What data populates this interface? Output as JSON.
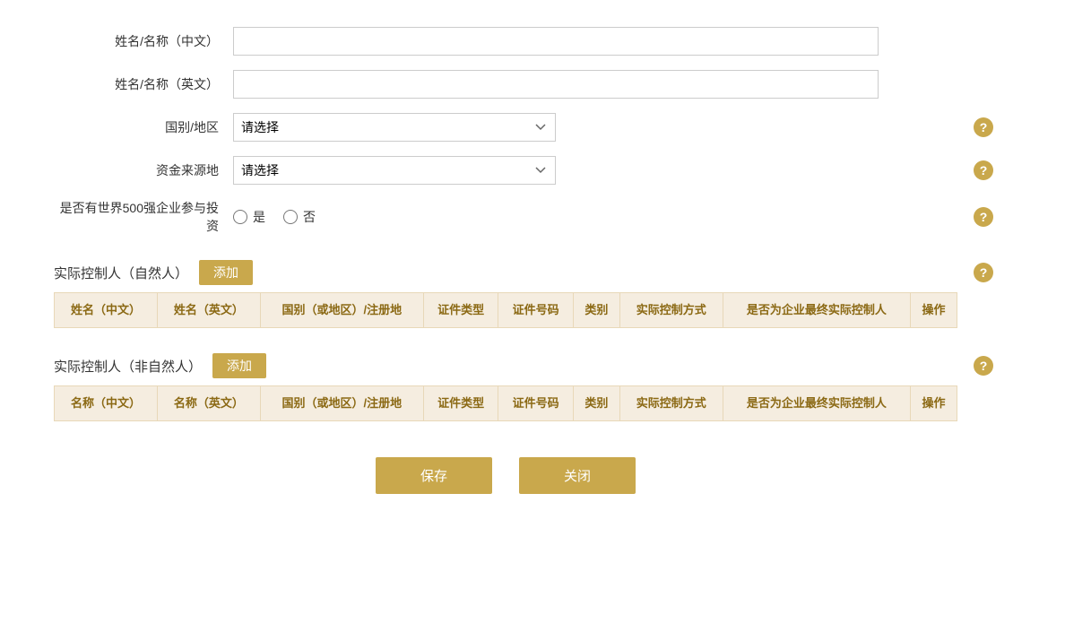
{
  "form": {
    "name_cn_label": "姓名/名称（中文）",
    "name_en_label": "姓名/名称（英文）",
    "country_label": "国别/地区",
    "country_placeholder": "请选择",
    "funds_label": "资金来源地",
    "funds_placeholder": "请选择",
    "fortune500_label": "是否有世界500强企业参与投资",
    "yes_label": "是",
    "no_label": "否"
  },
  "natural_person_section": {
    "title": "实际控制人（自然人）",
    "add_button": "添加",
    "columns": [
      "姓名（中文）",
      "姓名（英文）",
      "国别（或地区）/注册地",
      "证件类型",
      "证件号码",
      "类别",
      "实际控制方式",
      "是否为企业最终实际控制人",
      "操作"
    ]
  },
  "non_natural_person_section": {
    "title": "实际控制人（非自然人）",
    "add_button": "添加",
    "columns": [
      "名称（中文）",
      "名称（英文）",
      "国别（或地区）/注册地",
      "证件类型",
      "证件号码",
      "类别",
      "实际控制方式",
      "是否为企业最终实际控制人",
      "操作"
    ]
  },
  "buttons": {
    "save": "保存",
    "close": "关闭"
  },
  "help_icon": "?",
  "colors": {
    "gold": "#c9a84c",
    "table_header_bg": "#f5ede0",
    "table_header_text": "#8b6914",
    "table_border": "#e8d8b8"
  }
}
